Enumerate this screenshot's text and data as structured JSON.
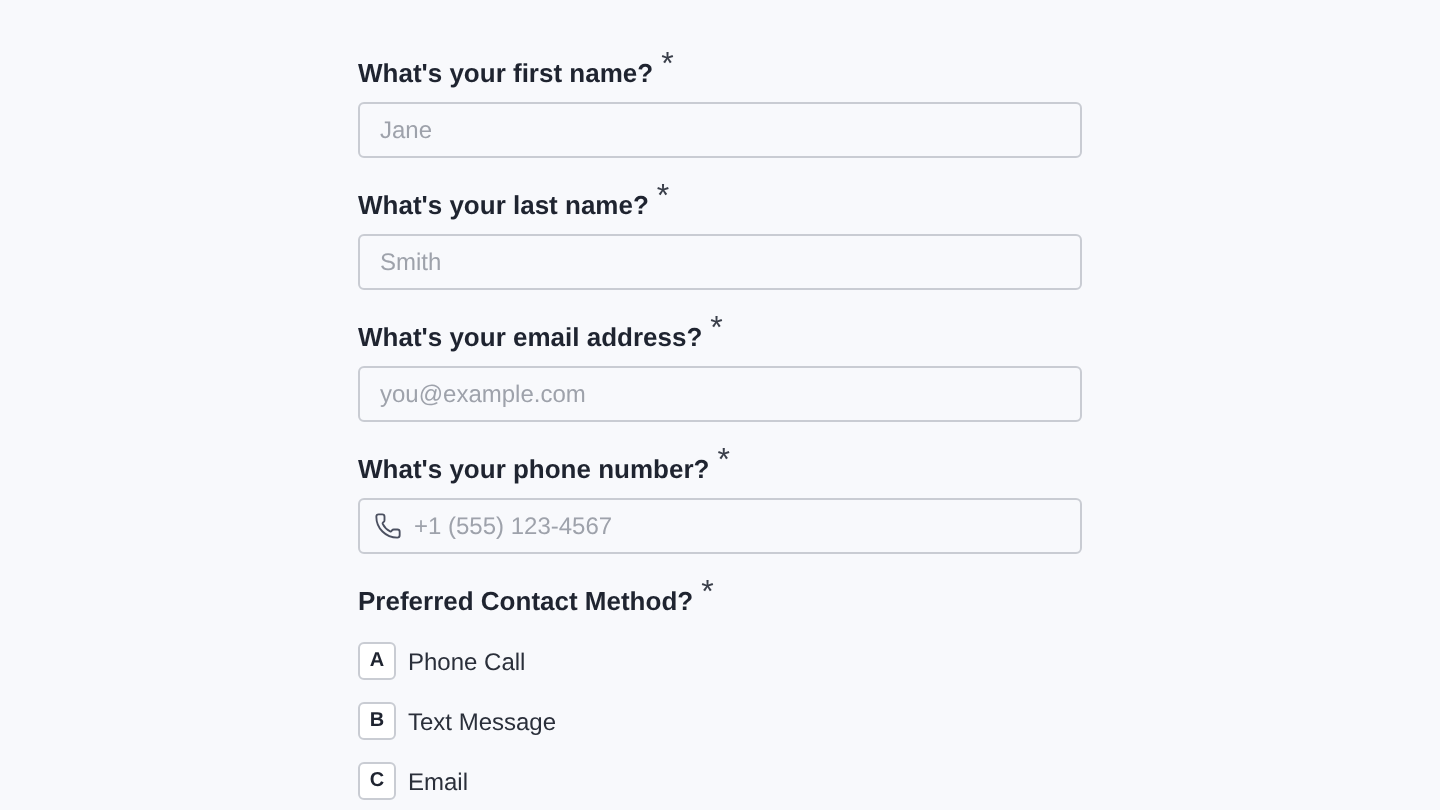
{
  "fields": [
    {
      "label": "What's your first name?",
      "required_mark": "*",
      "kind": "text",
      "placeholder": "Jane"
    },
    {
      "label": "What's your last name?",
      "required_mark": "*",
      "kind": "text",
      "placeholder": "Smith"
    },
    {
      "label": "What's your email address?",
      "required_mark": "*",
      "kind": "text",
      "placeholder": "you@example.com"
    },
    {
      "label": "What's your phone number?",
      "required_mark": "*",
      "kind": "phone",
      "placeholder": "+1 (555) 123-4567"
    }
  ],
  "contact_method": {
    "label": "Preferred Contact Method?",
    "required_mark": "*",
    "options": [
      {
        "key": "A",
        "label": "Phone Call",
        "selected": false
      },
      {
        "key": "B",
        "label": "Text Message",
        "selected": false
      },
      {
        "key": "C",
        "label": "Email",
        "selected": false
      }
    ]
  }
}
